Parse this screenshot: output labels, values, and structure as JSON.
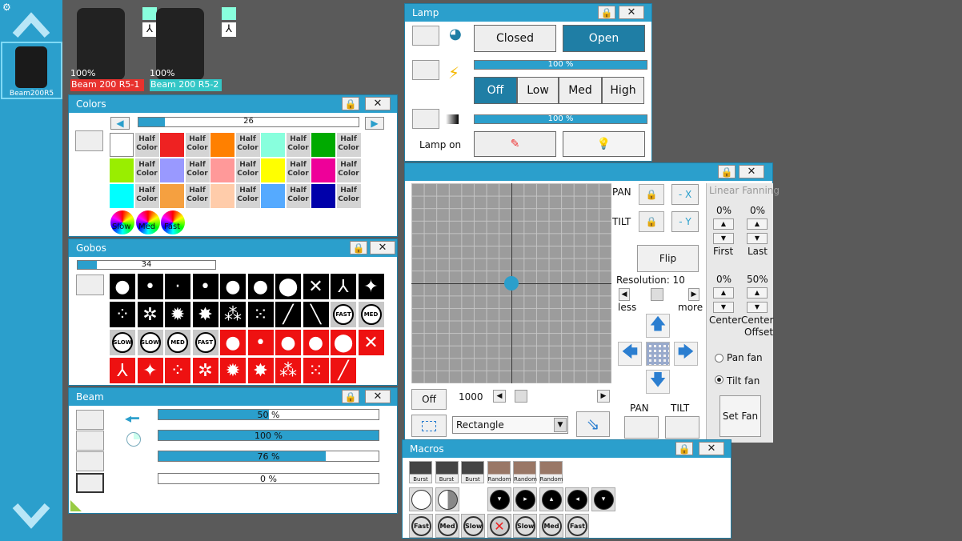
{
  "sidebar": {
    "fixture_label": "Beam200R5"
  },
  "fixtures": [
    {
      "percent": "100%",
      "name": "Beam 200 R5-1",
      "color": "#e8322e"
    },
    {
      "percent": "100%",
      "name": "Beam 200 R5-2",
      "color": "#34c7c7"
    }
  ],
  "colors": {
    "title": "Colors",
    "position": "26",
    "position_fill": 0.12,
    "half_label_1": "Half",
    "half_label_2": "Color",
    "speed": [
      "Slow",
      "Med",
      "Fast"
    ],
    "grid": [
      [
        "#ffffff",
        "half",
        "#ee2222",
        "half",
        "#ff8000",
        "half",
        "#88ffdd",
        "half",
        "#00aa00",
        "half"
      ],
      [
        "#99ee00",
        "half",
        "#9999ff",
        "half",
        "#ff9999",
        "half",
        "#ffff00",
        "half",
        "#ee0099",
        "half"
      ],
      [
        "#00ffff",
        "half",
        "#f5a040",
        "half",
        "#ffccaa",
        "half",
        "#55aaff",
        "half",
        "#0000aa",
        "half"
      ]
    ]
  },
  "gobos": {
    "title": "Gobos",
    "position": "34",
    "position_fill": 0.14
  },
  "beam": {
    "title": "Beam",
    "bars": [
      {
        "label": "50 %",
        "value": 0.5
      },
      {
        "label": "100 %",
        "value": 1.0
      },
      {
        "label": "76 %",
        "value": 0.76
      },
      {
        "label": "0 %",
        "value": 0.0
      }
    ]
  },
  "lamp": {
    "title": "Lamp",
    "closed": "Closed",
    "open": "Open",
    "shutter_pct": "100 %",
    "off": "Off",
    "low": "Low",
    "med": "Med",
    "high": "High",
    "dimmer_pct": "100 %",
    "lamp_on": "Lamp on"
  },
  "position": {
    "pan": "PAN",
    "tilt": "TILT",
    "neg_x": "- X",
    "neg_y": "- Y",
    "flip": "Flip",
    "resolution": "Resolution: 10",
    "less": "less",
    "more": "more",
    "off": "Off",
    "speed_value": "1000",
    "shape": "Rectangle",
    "pan_label": "PAN",
    "tilt_label": "TILT",
    "fanning_title": "Linear Fanning",
    "first_pct": "0%",
    "last_pct": "0%",
    "first": "First",
    "last": "Last",
    "center_pct": "0%",
    "center_offset_pct": "50%",
    "center": "Center",
    "center_offset_1": "Center",
    "center_offset_2": "Offset",
    "pan_fan": "Pan fan",
    "tilt_fan": "Tilt fan",
    "set_fan": "Set Fan"
  },
  "macros": {
    "title": "Macros",
    "row1": [
      "Burst",
      "Burst",
      "Burst",
      "Random",
      "Random",
      "Random"
    ],
    "row3": [
      "Fast",
      "Med",
      "Slow",
      "",
      "Slow",
      "Med",
      "Fast"
    ]
  }
}
